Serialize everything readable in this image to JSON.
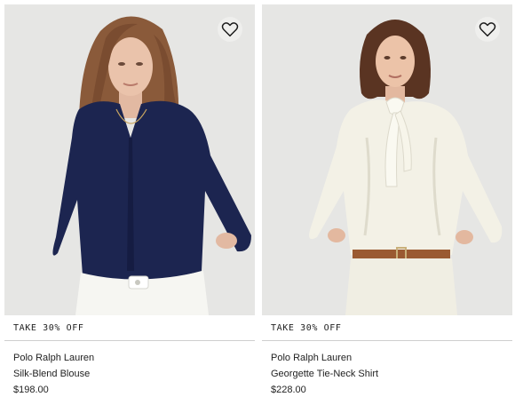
{
  "products": [
    {
      "promo": "TAKE 30% OFF",
      "brand": "Polo Ralph Lauren",
      "name": "Silk-Blend Blouse",
      "price": "$198.00",
      "favorite_icon": "heart-outline-icon",
      "image": "model-navy-blouse",
      "garment_color": "#1c2550"
    },
    {
      "promo": "TAKE 30% OFF",
      "brand": "Polo Ralph Lauren",
      "name": "Georgette Tie-Neck Shirt",
      "price": "$228.00",
      "favorite_icon": "heart-outline-icon",
      "image": "model-ivory-tie-neck-shirt",
      "garment_color": "#f3f1e6"
    }
  ],
  "colors": {
    "photo_background": "#e6e6e4",
    "text": "#222222",
    "divider": "#cfcfcf"
  }
}
